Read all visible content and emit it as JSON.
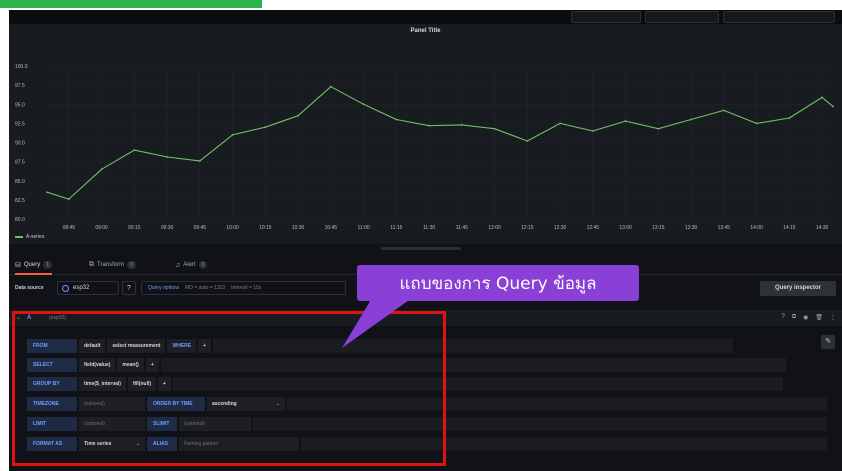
{
  "colors": {
    "series": "#73bf69",
    "accent": "#6e9fff",
    "annotation_box": "#e01313",
    "callout_bg": "#8a3fd6",
    "active_tab_underline": "#f55f3e"
  },
  "panel": {
    "title": "Panel Title"
  },
  "chart_data": {
    "type": "line",
    "title": "Panel Title",
    "y_ticks": [
      "100.0",
      "97.5",
      "95.0",
      "92.5",
      "90.0",
      "87.5",
      "85.0",
      "82.5",
      "80.0"
    ],
    "x_ticks": [
      "08:45",
      "09:00",
      "09:15",
      "09:30",
      "09:45",
      "10:00",
      "10:15",
      "10:30",
      "10:45",
      "11:00",
      "11:15",
      "11:30",
      "11:45",
      "12:00",
      "12:15",
      "12:30",
      "12:45",
      "13:00",
      "13:15",
      "13:30",
      "13:45",
      "14:00",
      "14:15",
      "14:30"
    ],
    "ylim": [
      80,
      100
    ],
    "grid": true,
    "legend": "bottom-left",
    "series": [
      {
        "name": "A-series",
        "x": [
          "08:35",
          "08:45",
          "09:00",
          "09:15",
          "09:30",
          "09:45",
          "10:00",
          "10:15",
          "10:30",
          "10:45",
          "11:00",
          "11:15",
          "11:30",
          "11:45",
          "12:00",
          "12:15",
          "12:30",
          "12:45",
          "13:00",
          "13:15",
          "13:30",
          "13:45",
          "14:00",
          "14:15",
          "14:30",
          "14:35"
        ],
        "values": [
          83.5,
          82.6,
          86.5,
          89.0,
          88.1,
          87.6,
          91.0,
          92.0,
          93.5,
          97.3,
          95.0,
          93.0,
          92.2,
          92.3,
          91.8,
          90.2,
          92.5,
          91.5,
          92.8,
          91.8,
          93.0,
          94.2,
          92.5,
          93.2,
          95.9,
          94.7
        ]
      }
    ]
  },
  "legend": {
    "label": "A-series"
  },
  "tabs": [
    {
      "label": "Query",
      "count": "1"
    },
    {
      "label": "Transform",
      "count": "0"
    },
    {
      "label": "Alert",
      "count": "0"
    }
  ],
  "datasource": {
    "label": "Data source",
    "value": "esp32",
    "help": "?"
  },
  "query_options": {
    "link": "Query options",
    "summary": "MD = auto = 1313",
    "interval": "Interval = 15s"
  },
  "query_inspector": "Query inspector",
  "query": {
    "letter": "A",
    "datasource_name": "(esp32)",
    "from": {
      "kw": "FROM",
      "policy": "default",
      "measurement": "select measurement",
      "where": "WHERE",
      "plus": "+"
    },
    "select": {
      "kw": "SELECT",
      "field": "field(value)",
      "fn": "mean()",
      "plus": "+"
    },
    "group_by": {
      "kw": "GROUP BY",
      "time": "time($_interval)",
      "fill": "fill(null)",
      "plus": "+"
    },
    "timezone": {
      "kw": "TIMEZONE",
      "placeholder": "(optional)",
      "order_kw": "ORDER BY TIME",
      "order_value": "ascending"
    },
    "limit": {
      "kw": "LIMIT",
      "placeholder": "(optional)",
      "slimit_kw": "SLIMIT",
      "slimit_placeholder": "(optional)"
    },
    "format": {
      "kw": "FORMAT AS",
      "value": "Time series",
      "alias_kw": "ALIAS",
      "alias_placeholder": "Naming pattern"
    }
  },
  "annotation": {
    "callout": "แถบของการ Query ข้อมูล"
  }
}
